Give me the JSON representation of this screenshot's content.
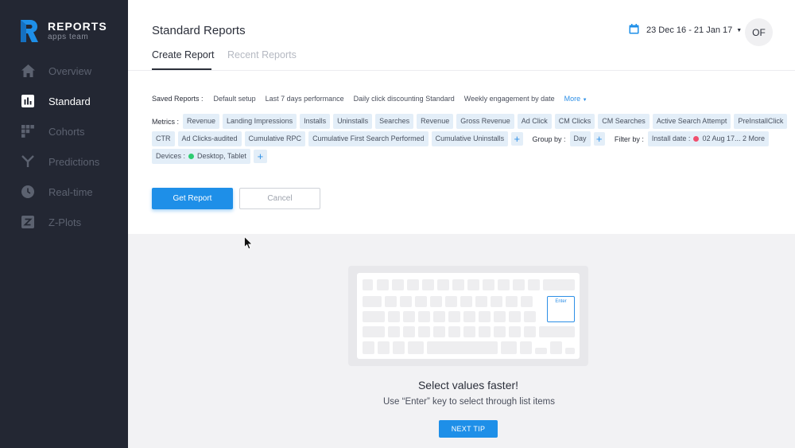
{
  "brand": {
    "title": "REPORTS",
    "subtitle": "apps team"
  },
  "sidebar": {
    "items": [
      {
        "label": "Overview",
        "icon": "home-icon",
        "active": false
      },
      {
        "label": "Standard",
        "icon": "bar-chart-icon",
        "active": true
      },
      {
        "label": "Cohorts",
        "icon": "cohorts-grid-icon",
        "active": false
      },
      {
        "label": "Predictions",
        "icon": "fork-icon",
        "active": false
      },
      {
        "label": "Real-time",
        "icon": "clock-icon",
        "active": false
      },
      {
        "label": "Z-Plots",
        "icon": "z-box-icon",
        "active": false
      }
    ]
  },
  "header": {
    "title": "Standard Reports",
    "tabs": [
      {
        "label": "Create Report",
        "active": true
      },
      {
        "label": "Recent Reports",
        "active": false
      }
    ],
    "date_range": "23 Dec 16 - 21 Jan 17",
    "avatar_initials": "OF"
  },
  "saved_reports": {
    "label": "Saved Reports :",
    "items": [
      "Default setup",
      "Last 7 days performance",
      "Daily click discounting Standard",
      "Weekly engagement by date"
    ],
    "more": "More"
  },
  "metrics": {
    "label": "Metrics :",
    "chips_line1": [
      "Revenue",
      "Landing Impressions",
      "Installs",
      "Uninstalls",
      "Searches",
      "Revenue",
      "Gross Revenue",
      "Ad Click",
      "CM Clicks",
      "CM Searches",
      "Active Search Attempt",
      "PreInstallClick"
    ],
    "chips_line2": [
      "CTR",
      "Ad Clicks-audited",
      "Cumulative RPC",
      "Cumulative First Search Performed",
      "Cumulative Uninstalls"
    ]
  },
  "group_by": {
    "label": "Group by :",
    "value": "Day"
  },
  "filter_by": {
    "label": "Filter by :",
    "prefix": "Install date :",
    "value": "02 Aug 17... 2 More",
    "dot_color": "#f0506e"
  },
  "devices": {
    "label": "Devices :",
    "value": "Desktop, Tablet",
    "dot_color": "#2ecc71"
  },
  "plus_symbol": "+",
  "buttons": {
    "get_report": "Get Report",
    "cancel": "Cancel"
  },
  "tip": {
    "enter_key_label": "Enter",
    "title": "Select values faster!",
    "subtitle": "Use “Enter” key to select through list items",
    "next_button": "NEXT TIP"
  },
  "colors": {
    "accent": "#1e8fe8",
    "sidebar_bg": "#232733",
    "chip_bg": "#e3eef8"
  }
}
